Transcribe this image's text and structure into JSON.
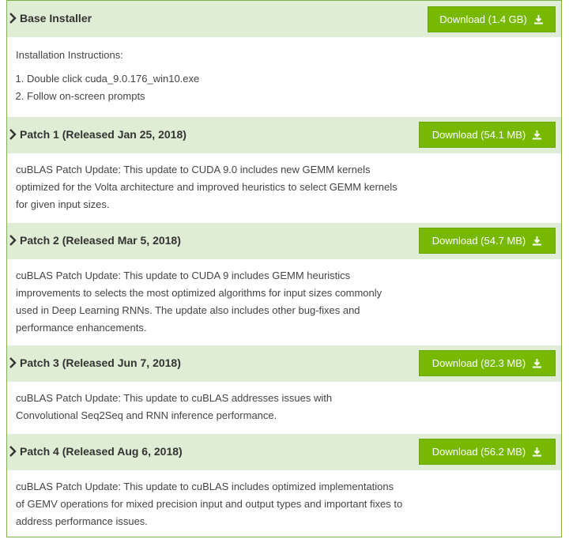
{
  "sections": [
    {
      "title": "Base Installer",
      "download_label": "Download (1.4 GB)",
      "instructions_heading": "Installation Instructions:",
      "steps": [
        "Double click cuda_9.0.176_win10.exe",
        "Follow on-screen prompts"
      ]
    },
    {
      "title": "Patch 1 (Released Jan 25, 2018)",
      "download_label": "Download (54.1 MB)",
      "description": "cuBLAS Patch Update: This update to CUDA 9.0 includes new GEMM kernels optimized for the Volta architecture and improved heuristics to select GEMM kernels for given input sizes."
    },
    {
      "title": "Patch 2 (Released Mar 5, 2018)",
      "download_label": "Download (54.7 MB)",
      "description": "cuBLAS Patch Update: This update to CUDA 9 includes GEMM heuristics improvements to selects the most optimized algorithms for input sizes commonly used in Deep Learning RNNs. The update also includes other bug-fixes and performance enhancements."
    },
    {
      "title": "Patch 3 (Released Jun 7, 2018)",
      "download_label": "Download (82.3 MB)",
      "description": "cuBLAS Patch Update: This update to cuBLAS addresses issues with Convolutional Seq2Seq and RNN inference performance."
    },
    {
      "title": "Patch 4 (Released Aug 6, 2018)",
      "download_label": "Download (56.2 MB)",
      "description": "cuBLAS Patch Update: This update to cuBLAS includes optimized implementations of GEMV operations for mixed precision input and output types and important fixes to address performance issues."
    }
  ],
  "colors": {
    "header_bg": "#dfedd5",
    "button_bg": "#76b900",
    "border": "#7cb342"
  },
  "icons": {
    "chevron": "chevron-right-icon",
    "download": "download-icon"
  }
}
